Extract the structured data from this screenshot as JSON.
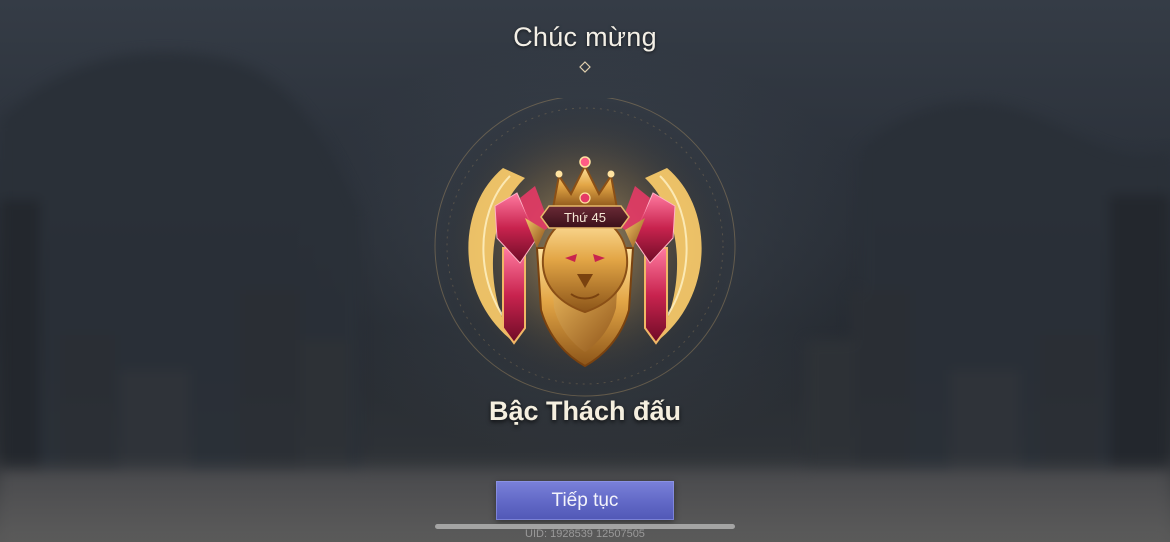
{
  "header": {
    "title": "Chúc mừng"
  },
  "rank": {
    "badge_label": "Thứ 45",
    "name": "Bậc Thách đấu"
  },
  "actions": {
    "continue_label": "Tiếp tục"
  },
  "footer": {
    "uid_text": "UID: 1928539 12507505"
  },
  "colors": {
    "button": "#6168c6",
    "gold": "#e8b04a",
    "crimson": "#c0264c",
    "title_text": "#f3efe6"
  },
  "icons": {
    "emblem": "lion-crest-emblem",
    "divider": "diamond-divider"
  }
}
